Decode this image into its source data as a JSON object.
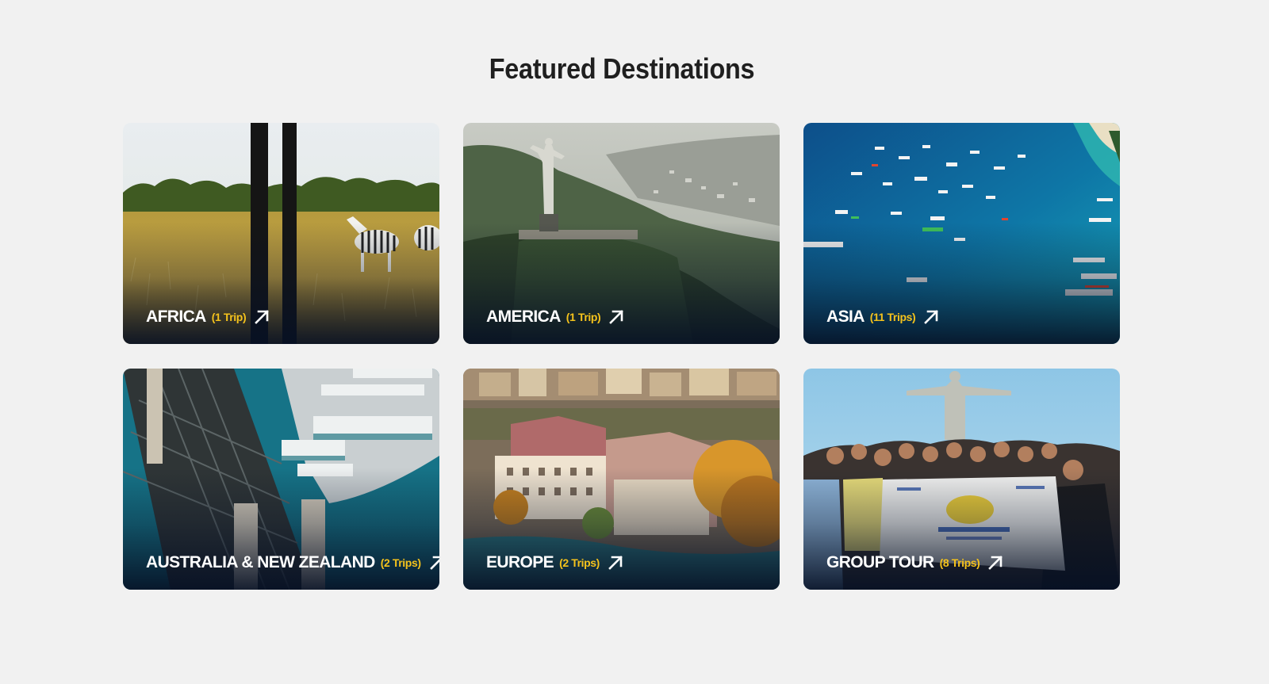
{
  "section": {
    "title": "Featured Destinations"
  },
  "destinations": [
    {
      "name": "AFRICA",
      "count": "(1 Trip)",
      "icon": "arrow-up-right-icon"
    },
    {
      "name": "AMERICA",
      "count": "(1 Trip)",
      "icon": "arrow-up-right-icon"
    },
    {
      "name": "ASIA",
      "count": "(11 Trips)",
      "icon": "arrow-up-right-icon"
    },
    {
      "name": "AUSTRALIA & NEW ZEALAND",
      "count": "(2 Trips)",
      "icon": "arrow-up-right-icon"
    },
    {
      "name": "EUROPE",
      "count": "(2 Trips)",
      "icon": "arrow-up-right-icon"
    },
    {
      "name": "GROUP TOUR",
      "count": "(8 Trips)",
      "icon": "arrow-up-right-icon"
    }
  ],
  "colors": {
    "background": "#f1f1f1",
    "title": "#1f1f1f",
    "label": "#ffffff",
    "count": "#f4c21c"
  }
}
